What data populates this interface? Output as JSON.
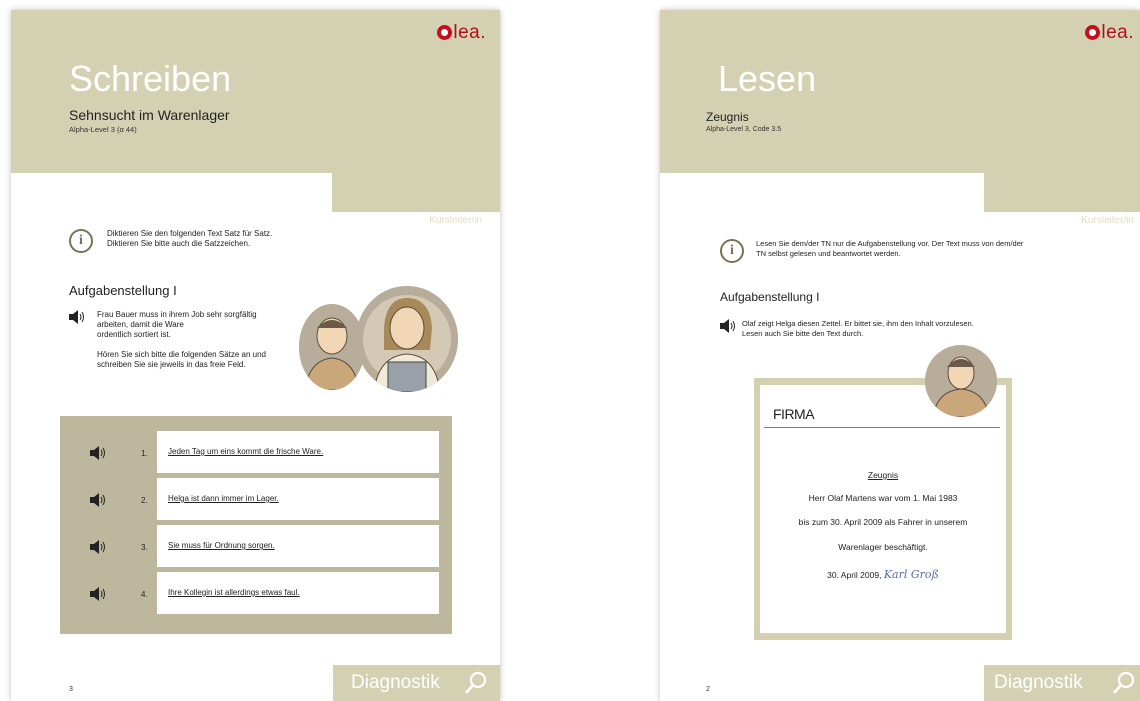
{
  "left_page": {
    "logo": "lea.",
    "title": "Schreiben",
    "subtitle": "Sehnsucht im Warenlager",
    "level": "Alpha-Level 3 (α 44)",
    "role": "Kursleiter/in",
    "info_line1": "Diktieren Sie den folgenden Text Satz für Satz.",
    "info_line2": "Diktieren Sie bitte auch die Satzzeichen.",
    "heading": "Aufgabenstellung I",
    "para1_line1": "Frau Bauer muss in ihrem Job sehr sorgfältig",
    "para1_line2": "arbeiten, damit die Ware",
    "para1_line3": "ordentlich sortiert ist.",
    "para2_line1": "Hören Sie sich bitte die folgenden Sätze an und",
    "para2_line2": "schreiben Sie sie jeweils in das freie Feld.",
    "tasks": [
      {
        "num": "1.",
        "text": "Jeden Tag um eins kommt die frische Ware."
      },
      {
        "num": "2.",
        "text": "Helga ist dann immer im Lager."
      },
      {
        "num": "3.",
        "text": "Sie muss für Ordnung sorgen."
      },
      {
        "num": "4.",
        "text": "Ihre Kollegin ist allerdings etwas faul."
      }
    ],
    "page_number": "3",
    "footer": "Diagnostik"
  },
  "right_page": {
    "logo": "lea.",
    "title": "Lesen",
    "subtitle": "Zeugnis",
    "level": "Alpha-Level 3, Code 3.5",
    "role": "Kursleiter/in",
    "info_line1": "Lesen Sie dem/der TN nur die Aufgabenstellung vor. Der Text muss von dem/der",
    "info_line2": "TN selbst gelesen und beantwortet werden.",
    "heading": "Aufgabenstellung I",
    "para_line1": "Olaf zeigt Helga diesen Zettel. Er bittet sie, ihm den Inhalt vorzulesen.",
    "para_line2": "Lesen auch Sie bitte den Text durch.",
    "doc": {
      "brand": "FIRMA",
      "title": "Zeugnis",
      "line1": "Herr Olaf Martens war vom 1. Mai 1983",
      "line2": "bis zum 30. April 2009 als Fahrer in unserem",
      "line3": "Warenlager beschäftigt.",
      "date": "30. April 2009,",
      "signature": "Karl Groß"
    },
    "page_number": "2",
    "footer": "Diagnostik"
  },
  "colors": {
    "header": "#d4d1b3",
    "task_box": "#bdb89d",
    "logo_red": "#c4101c",
    "rule": "#d8622a"
  }
}
